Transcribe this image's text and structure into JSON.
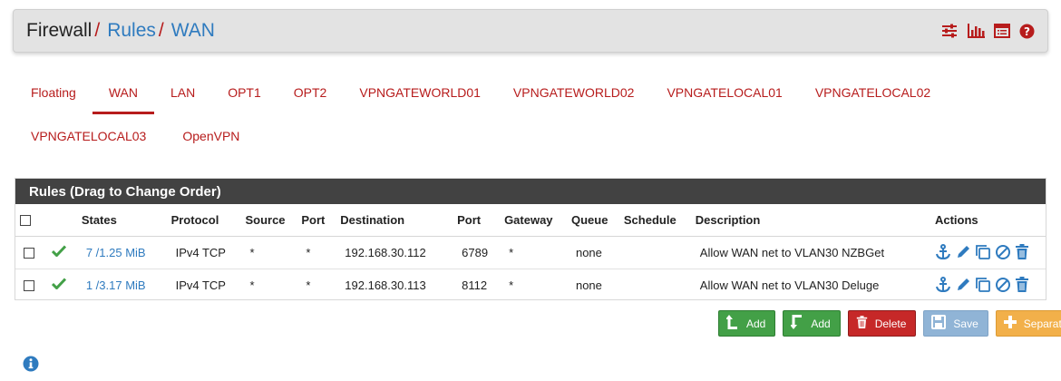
{
  "breadcrumb": {
    "root": "Firewall",
    "level1": "Rules",
    "level2": "WAN",
    "separator": "/"
  },
  "header_icons": [
    "sliders-icon",
    "bar-chart-icon",
    "table-icon",
    "help-icon"
  ],
  "tabs": {
    "row1": [
      "Floating",
      "WAN",
      "LAN",
      "OPT1",
      "OPT2",
      "VPNGATEWORLD01",
      "VPNGATEWORLD02",
      "VPNGATELOCAL01",
      "VPNGATELOCAL02"
    ],
    "row2": [
      "VPNGATELOCAL03",
      "OpenVPN"
    ],
    "active": "WAN"
  },
  "panel": {
    "title": "Rules (Drag to Change Order)"
  },
  "table": {
    "columns": [
      "States",
      "Protocol",
      "Source",
      "Port",
      "Destination",
      "Port",
      "Gateway",
      "Queue",
      "Schedule",
      "Description",
      "Actions"
    ],
    "rows": [
      {
        "states": "7 /1.25 MiB",
        "protocol": "IPv4 TCP",
        "source": "*",
        "source_port": "*",
        "destination": "192.168.30.112",
        "dest_port": "6789",
        "gateway": "*",
        "queue": "none",
        "schedule": "",
        "description": "Allow WAN net to VLAN30 NZBGet"
      },
      {
        "states": "1 /3.17 MiB",
        "protocol": "IPv4 TCP",
        "source": "*",
        "source_port": "*",
        "destination": "192.168.30.113",
        "dest_port": "8112",
        "gateway": "*",
        "queue": "none",
        "schedule": "",
        "description": "Allow WAN net to VLAN30 Deluge"
      }
    ]
  },
  "buttons": {
    "add_top": "Add",
    "add_bottom": "Add",
    "delete": "Delete",
    "save": "Save",
    "separator": "Separator"
  },
  "colors": {
    "accent_red": "#b71c1c",
    "link_blue": "#2f7bbf",
    "panel_header": "#424242",
    "check_green": "#43a047"
  }
}
